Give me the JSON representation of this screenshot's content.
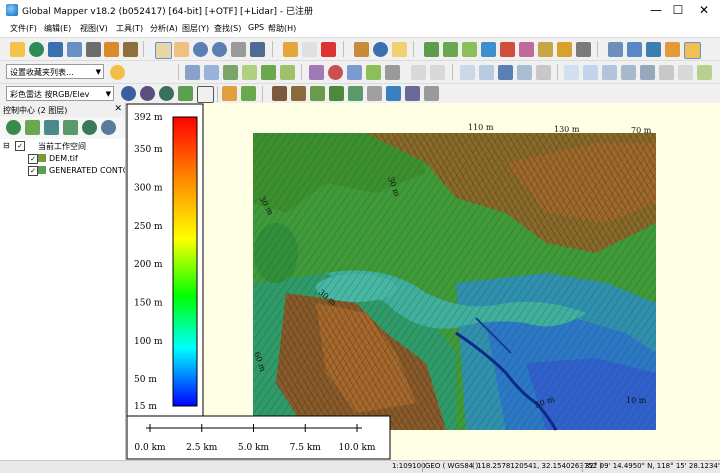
{
  "window": {
    "title": "Global Mapper v18.2 (b052417) [64-bit] [+OTF] [+Lidar] - 已注册",
    "minimize": "—",
    "maximize": "☐",
    "close": "✕"
  },
  "menu": [
    "文件(F)",
    "编辑(E)",
    "视图(V)",
    "工具(T)",
    "分析(A)",
    "图层(Y)",
    "查找(S)",
    "GPS",
    "帮助(H)"
  ],
  "toolbar": {
    "favorites_combo": "设置收藏夹列表...",
    "shader_combo": "彩色雷达 按RGB/Elev"
  },
  "panel": {
    "title": "控制中心 (2 图层)",
    "close": "✕",
    "tree": {
      "workspace": "当前工作空间",
      "layers": [
        "DEM.tif",
        "GENERATED CONTOURS"
      ]
    }
  },
  "legend": {
    "labels": [
      "392 m",
      "350 m",
      "300 m",
      "250 m",
      "200 m",
      "150 m",
      "100 m",
      "50 m",
      "15 m"
    ],
    "values": [
      392,
      350,
      300,
      250,
      200,
      150,
      100,
      50,
      15
    ]
  },
  "scalebar": {
    "labels": [
      "0.0 km",
      "2.5 km",
      "5.0 km",
      "7.5 km",
      "10.0 km"
    ]
  },
  "contour_labels": [
    "110 m",
    "130 m",
    "70 m",
    "30 m",
    "30 m",
    "30 m",
    "60 m",
    "50 m",
    "10 m"
  ],
  "status": {
    "scale": "1:109100",
    "crs": "GEO ( WGS84 )",
    "coords": "( 118.2578120541, 32.1540263752 )",
    "dms": "32° 09' 14.4950\" N, 118° 15' 28.1234\" E"
  },
  "colors": {
    "legend_top": "#ff0000",
    "legend_bottom": "#0000ff",
    "map_background": "#ffffe6"
  }
}
